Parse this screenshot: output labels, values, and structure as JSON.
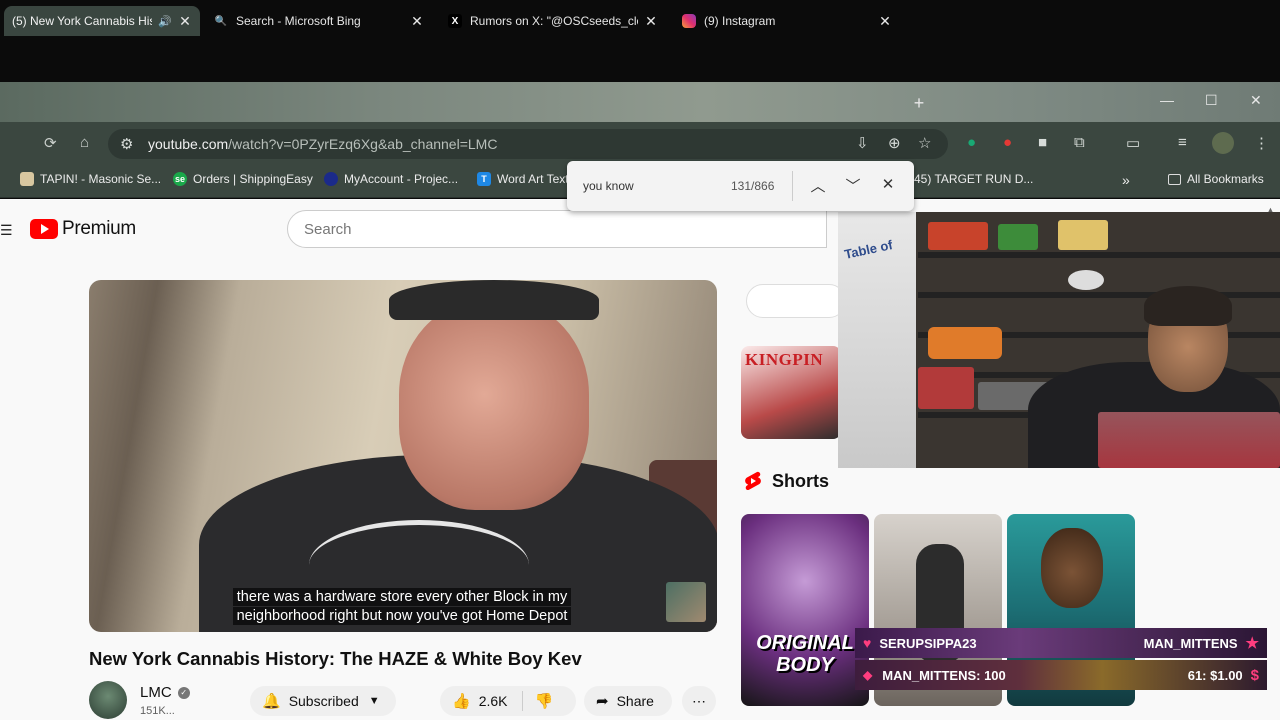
{
  "tabs": [
    {
      "title": "(5) New York Cannabis His",
      "icon": "youtube-icon",
      "active": true
    },
    {
      "title": "Search - Microsoft Bing",
      "icon": "bing-search-icon"
    },
    {
      "title": "Rumors on X: \"@OSCseeds_clo",
      "icon": "x-logo-icon"
    },
    {
      "title": "(9) Instagram",
      "icon": "instagram-icon"
    }
  ],
  "address": {
    "host": "youtube.com",
    "path": "/watch?v=0PZyrEzq6Xg&ab_channel=LMC"
  },
  "bookmarks": [
    {
      "label": "TAPIN! - Masonic Se..."
    },
    {
      "label": "Orders | ShippingEasy"
    },
    {
      "label": "MyAccount - Projec..."
    },
    {
      "label": "Word Art Text"
    },
    {
      "label": "45) TARGET RUN D..."
    }
  ],
  "bookmarks_overflow": "»",
  "all_bookmarks": "All Bookmarks",
  "find": {
    "query": "you know",
    "count": "131/866"
  },
  "youtube": {
    "logo_text": "Premium",
    "search_placeholder": "Search"
  },
  "video": {
    "caption_line1": "there was a hardware store every other Block in my",
    "caption_line2": "neighborhood right but now you've got Home Depot",
    "title": "New York Cannabis History: The HAZE & White Boy Kev",
    "channel": "LMC",
    "subscribers": "151K...",
    "subscribed_label": "Subscribed",
    "likes": "2.6K",
    "share_label": "Share"
  },
  "sidebar": {
    "thumb_text": "KINGPIN",
    "shorts_label": "Shorts",
    "short1_text": "ORIGINAL BODY"
  },
  "webcam": {
    "poster_text": "Table of"
  },
  "alerts": [
    {
      "left": "SERUPSIPPA23",
      "right": "MAN_MITTENS"
    },
    {
      "left": "MAN_MITTENS: 100",
      "right": "61: $1.00"
    }
  ]
}
